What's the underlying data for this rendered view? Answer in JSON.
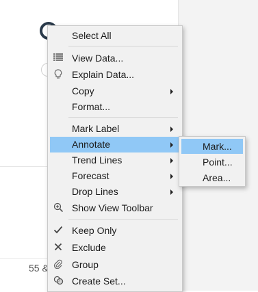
{
  "background": {
    "partial_label": "55 &"
  },
  "menu": {
    "items": [
      {
        "label": "Select All",
        "icon": "",
        "submenu": false
      },
      {
        "label": "View Data...",
        "icon": "table-icon",
        "submenu": false
      },
      {
        "label": "Explain Data...",
        "icon": "lightbulb-icon",
        "submenu": false
      },
      {
        "label": "Copy",
        "icon": "",
        "submenu": true
      },
      {
        "label": "Format...",
        "icon": "",
        "submenu": false
      },
      {
        "label": "Mark Label",
        "icon": "",
        "submenu": true
      },
      {
        "label": "Annotate",
        "icon": "",
        "submenu": true,
        "active": true
      },
      {
        "label": "Trend Lines",
        "icon": "",
        "submenu": true
      },
      {
        "label": "Forecast",
        "icon": "",
        "submenu": true
      },
      {
        "label": "Drop Lines",
        "icon": "",
        "submenu": true
      },
      {
        "label": "Show View Toolbar",
        "icon": "zoom-in-icon",
        "submenu": false
      },
      {
        "label": "Keep Only",
        "icon": "checkmark-icon",
        "submenu": false
      },
      {
        "label": "Exclude",
        "icon": "x-icon",
        "submenu": false
      },
      {
        "label": "Group",
        "icon": "paperclip-icon",
        "submenu": false
      },
      {
        "label": "Create Set...",
        "icon": "sets-icon",
        "submenu": false
      }
    ]
  },
  "submenu": {
    "items": [
      {
        "label": "Mark...",
        "active": true
      },
      {
        "label": "Point..."
      },
      {
        "label": "Area..."
      }
    ]
  },
  "colors": {
    "highlight": "#90c8f6",
    "menu_bg": "#f1f1f1"
  }
}
